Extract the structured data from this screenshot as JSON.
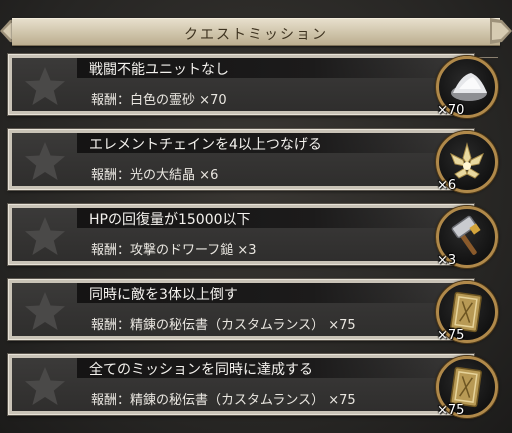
{
  "header": {
    "title": "クエストミッション"
  },
  "missions": [
    {
      "name": "戦闘不能ユニットなし",
      "reward_label": "報酬：",
      "reward_item": "白色の霊砂",
      "reward_count": "×70",
      "qty_badge": "×70",
      "icon": "white-sand-icon"
    },
    {
      "name": "エレメントチェインを4以上つなげる",
      "reward_label": "報酬：",
      "reward_item": "光の大結晶",
      "reward_count": "×6",
      "qty_badge": "×6",
      "icon": "light-crystal-icon"
    },
    {
      "name": "HPの回復量が15000以下",
      "reward_label": "報酬：",
      "reward_item": "攻撃のドワーフ鎚",
      "reward_count": "×3",
      "qty_badge": "×3",
      "icon": "dwarf-hammer-icon"
    },
    {
      "name": "同時に敵を3体以上倒す",
      "reward_label": "報酬：",
      "reward_item": "精錬の秘伝書（カスタムランス）",
      "reward_count": "×75",
      "qty_badge": "×75",
      "icon": "secret-book-icon"
    },
    {
      "name": "全てのミッションを同時に達成する",
      "reward_label": "報酬：",
      "reward_item": "精錬の秘伝書（カスタムランス）",
      "reward_count": "×75",
      "qty_badge": "×75",
      "icon": "secret-book-icon"
    }
  ],
  "colors": {
    "panel_border": "#c9c3b7",
    "item_frame": "#b0894a",
    "star_inactive": "#4a4948"
  }
}
